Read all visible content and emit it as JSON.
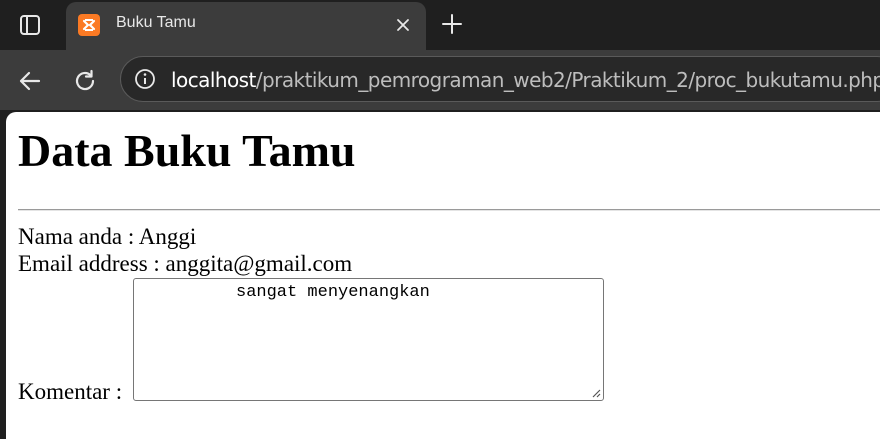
{
  "browser": {
    "tab": {
      "title": "Buku Tamu"
    },
    "address_bar": {
      "host": "localhost",
      "path": "/praktikum_pemrograman_web2/Praktikum_2/proc_bukutamu.php"
    },
    "icons": {
      "tab_actions": "tab-actions-icon",
      "favicon": "xampp-favicon-icon",
      "close": "close-icon",
      "new_tab": "plus-icon",
      "back": "back-arrow-icon",
      "reload": "reload-icon",
      "site_info": "info-icon"
    },
    "colors": {
      "favicon": "#fb7a24",
      "tab_active": "#3c3c3c",
      "frame": "#1f1f1f"
    }
  },
  "page": {
    "title": "Data Buku Tamu",
    "name_line": "Nama anda : Anggi",
    "email_line": "Email address : anggita@gmail.com",
    "comment_label": "Komentar :",
    "comment_value": "sangat menyenangkan"
  }
}
